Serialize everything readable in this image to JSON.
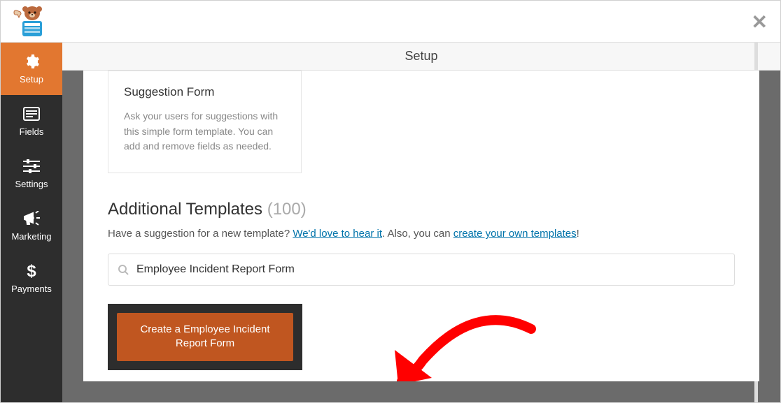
{
  "header": {
    "page_title": "Setup"
  },
  "sidebar": {
    "items": [
      {
        "label": "Setup"
      },
      {
        "label": "Fields"
      },
      {
        "label": "Settings"
      },
      {
        "label": "Marketing"
      },
      {
        "label": "Payments"
      }
    ]
  },
  "template_card": {
    "title": "Suggestion Form",
    "desc": "Ask your users for suggestions with this simple form template. You can add and remove fields as needed."
  },
  "additional": {
    "title": "Additional Templates",
    "count": "(100)",
    "prompt_pre": "Have a suggestion for a new template? ",
    "link1": "We'd love to hear it",
    "mid": ". Also, you can ",
    "link2": "create your own templates",
    "post": "!"
  },
  "search": {
    "value": "Employee Incident Report Form"
  },
  "result": {
    "button": "Create a Employee Incident Report Form"
  }
}
